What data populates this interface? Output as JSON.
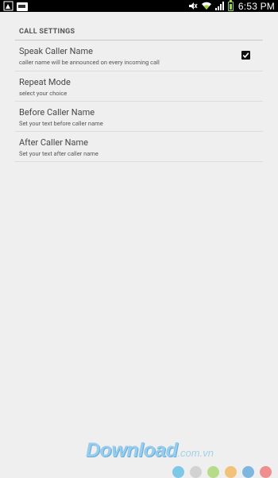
{
  "status_bar": {
    "time": "6:53 PM",
    "icons": [
      "notification-app-icon",
      "notification-app-icon-2",
      "mute-icon",
      "wifi-icon",
      "signal-icon",
      "battery-icon"
    ],
    "battery_color": "#9ad53a"
  },
  "settings": {
    "section_header": "CALL SETTINGS",
    "items": [
      {
        "title": "Speak Caller Name",
        "summary": "caller name will be announced on every incoming call",
        "checked": true
      },
      {
        "title": "Repeat Mode",
        "summary": "select your choice"
      },
      {
        "title": "Before Caller Name",
        "summary": "Set your text before caller name"
      },
      {
        "title": "After Caller Name",
        "summary": "Set your text after caller name"
      }
    ]
  },
  "watermark": {
    "brand": "Download",
    "domain": ".com.vn",
    "dot_colors": [
      "#7cc8e6",
      "#d2d2d2",
      "#b6dc8a",
      "#f3c27a",
      "#7fb6e0",
      "#ef8e8e"
    ]
  },
  "colors": {
    "background": "#efefef",
    "status_bar": "#000000",
    "divider": "#dcdcdc"
  }
}
